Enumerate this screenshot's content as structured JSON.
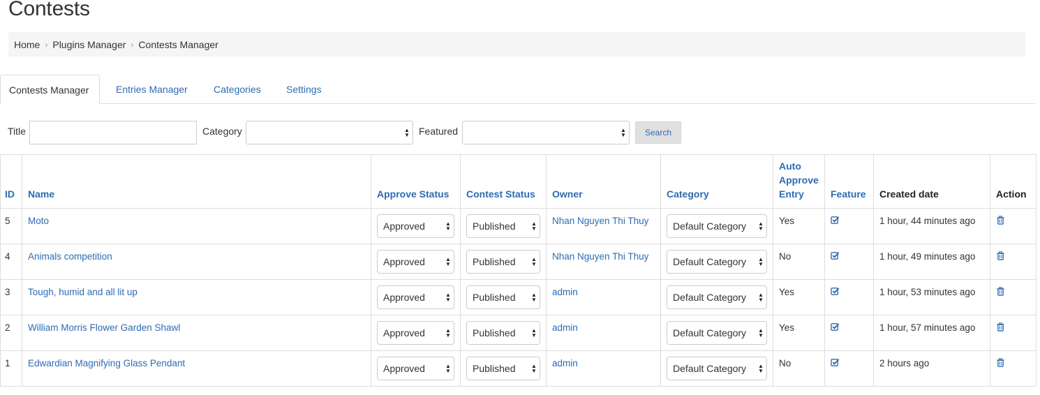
{
  "page": {
    "title": "Contests"
  },
  "breadcrumb": [
    "Home",
    "Plugins Manager",
    "Contests Manager"
  ],
  "tabs": [
    {
      "label": "Contests Manager",
      "active": true
    },
    {
      "label": "Entries Manager",
      "active": false
    },
    {
      "label": "Categories",
      "active": false
    },
    {
      "label": "Settings",
      "active": false
    }
  ],
  "filters": {
    "title_label": "Title",
    "title_value": "",
    "category_label": "Category",
    "category_value": "",
    "featured_label": "Featured",
    "featured_value": "",
    "search_label": "Search"
  },
  "table": {
    "headers": {
      "id": "ID",
      "name": "Name",
      "approve_status": "Approve Status",
      "contest_status": "Contest Status",
      "owner": "Owner",
      "category": "Category",
      "auto_approve": "Auto Approve Entry",
      "feature": "Feature",
      "created": "Created date",
      "action": "Action"
    },
    "rows": [
      {
        "id": "5",
        "name": "Moto",
        "approve": "Approved",
        "status": "Published",
        "owner": "Nhan Nguyen Thi Thuy",
        "category": "Default Category",
        "auto": "Yes",
        "created": "1 hour, 44 minutes ago"
      },
      {
        "id": "4",
        "name": "Animals competition",
        "approve": "Approved",
        "status": "Published",
        "owner": "Nhan Nguyen Thi Thuy",
        "category": "Default Category",
        "auto": "No",
        "created": "1 hour, 49 minutes ago"
      },
      {
        "id": "3",
        "name": "Tough, humid and all lit up",
        "approve": "Approved",
        "status": "Published",
        "owner": "admin",
        "category": "Default Category",
        "auto": "Yes",
        "created": "1 hour, 53 minutes ago"
      },
      {
        "id": "2",
        "name": "William Morris Flower Garden Shawl",
        "approve": "Approved",
        "status": "Published",
        "owner": "admin",
        "category": "Default Category",
        "auto": "Yes",
        "created": "1 hour, 57 minutes ago"
      },
      {
        "id": "1",
        "name": "Edwardian Magnifying Glass Pendant",
        "approve": "Approved",
        "status": "Published",
        "owner": "admin",
        "category": "Default Category",
        "auto": "No",
        "created": "2 hours ago"
      }
    ]
  },
  "icons": {
    "feature": "check-square-icon",
    "action": "trash-icon",
    "select": "select-arrows-icon"
  },
  "colors": {
    "link": "#2d6bb3",
    "breadcrumb_bg": "#f5f5f5",
    "border": "#dddddd"
  }
}
